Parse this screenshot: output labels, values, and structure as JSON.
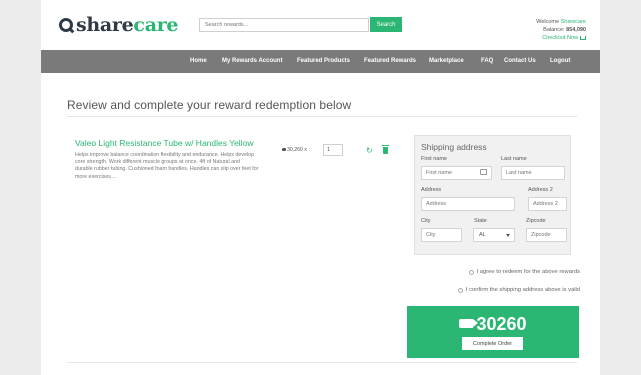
{
  "brand": {
    "logo_share": "share",
    "logo_care": "care",
    "accent": "#2bb673"
  },
  "search": {
    "placeholder": "Search rewards...",
    "button": "Search"
  },
  "account": {
    "welcome_prefix": "Welcome ",
    "user": "Sharecare",
    "balance_label": "Balance: ",
    "balance_value": "854,090",
    "checkout": "Checkout Now"
  },
  "nav": {
    "items": [
      "Home",
      "My Rewards Account",
      "Featured Products",
      "Featured Rewards",
      "Marketplace",
      "FAQ",
      "Contact Us",
      "Logout"
    ]
  },
  "page_title": "Review and complete your reward redemption below",
  "product": {
    "name": "Valeo Light Resistance Tube w/ Handles Yellow",
    "description": "Helps improve balance coordination flexibility and endurance. Helps develop core strength. Work different muscle groups at once. 4ft of Natural and durable rubber tubing. Cushioned foam handles. Handles can slip over feet for more exercises....",
    "price": "30,260 x",
    "quantity": "1"
  },
  "shipping": {
    "title": "Shipping address",
    "first_name_label": "First name",
    "first_name_placeholder": "First name",
    "last_name_label": "Last name",
    "last_name_placeholder": "Last name",
    "address_label": "Address",
    "address_placeholder": "Address",
    "address2_label": "Address 2",
    "address2_placeholder": "Address 2",
    "city_label": "City",
    "city_placeholder": "City",
    "state_label": "State",
    "state_value": "AL",
    "zip_label": "Zipcode",
    "zip_placeholder": "Zipcode"
  },
  "agreements": [
    "I agree to redeem for the above rewards",
    "I confirm the shipping address above is valid"
  ],
  "order": {
    "total": "30260",
    "button": "Complete Order"
  }
}
